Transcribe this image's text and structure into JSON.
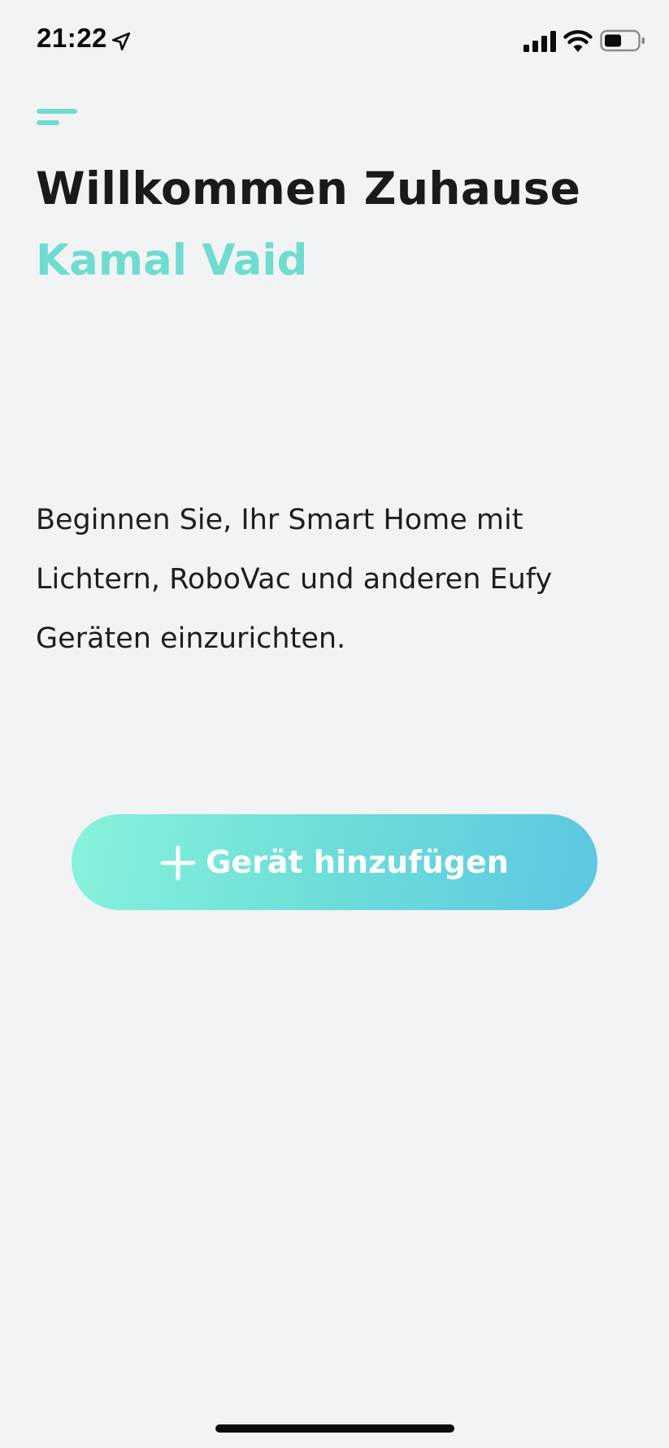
{
  "status_bar": {
    "time": "21:22",
    "icons": [
      "location-arrow-icon",
      "cellular-signal-icon",
      "wifi-icon",
      "battery-icon"
    ]
  },
  "menu": {
    "icon": "hamburger-menu-icon"
  },
  "header": {
    "title": "Willkommen Zuhause",
    "user_name": "Kamal Vaid"
  },
  "intro": {
    "text": "Beginnen Sie, Ihr Smart Home mit Lichtern, RoboVac und anderen Eufy Geräten einzurichten."
  },
  "add_device_button": {
    "icon": "plus-icon",
    "label": "Gerät hinzufügen"
  },
  "colors": {
    "accent": "#6fdcd0",
    "background": "#f2f3f5",
    "button_gradient_start": "#87f3dc",
    "button_gradient_end": "#5cc7e2",
    "text": "#1a1a1c"
  }
}
